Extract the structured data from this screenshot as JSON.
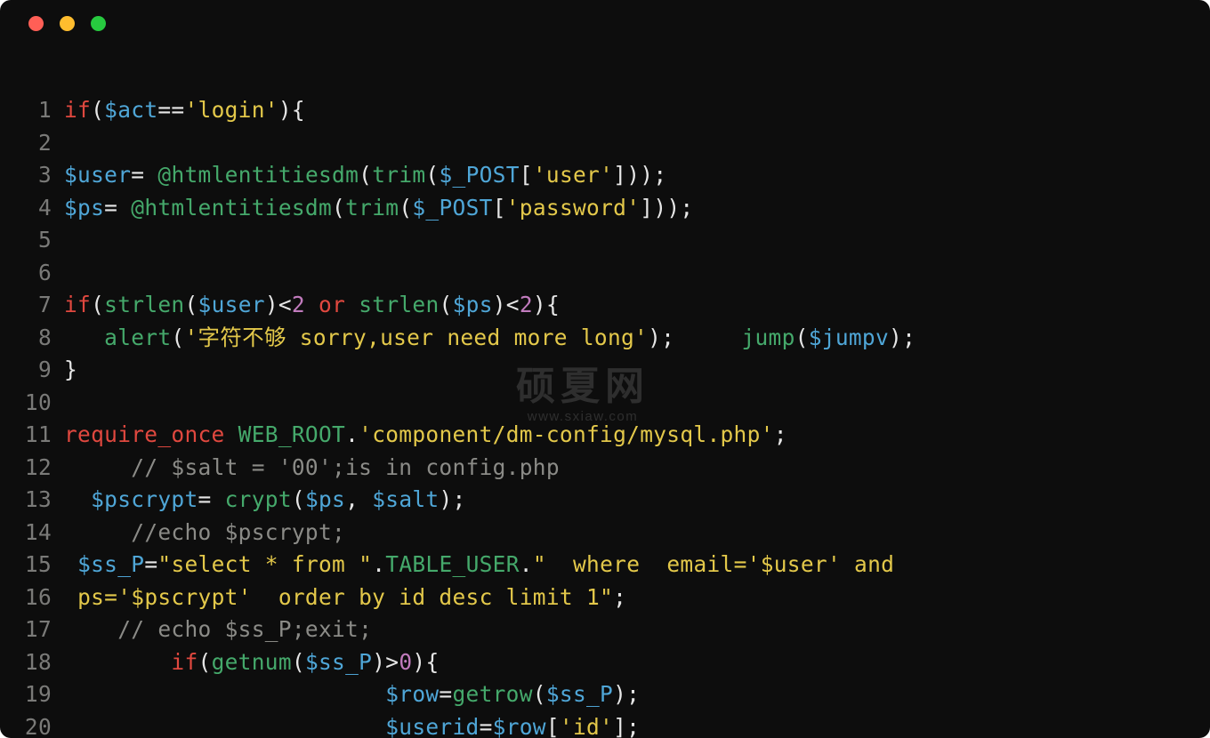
{
  "window": {
    "traffic_lights": [
      "red",
      "yellow",
      "green"
    ]
  },
  "watermark": {
    "title": "硕夏网",
    "url": "www.sxiaw.com"
  },
  "code": {
    "language": "php",
    "lines": [
      {
        "n": 1,
        "tokens": [
          [
            "kw",
            "if"
          ],
          [
            "p",
            "("
          ],
          [
            "var",
            "$act"
          ],
          [
            "p",
            "=="
          ],
          [
            "str",
            "'login'"
          ],
          [
            "p",
            "){"
          ]
        ]
      },
      {
        "n": 2,
        "tokens": []
      },
      {
        "n": 3,
        "tokens": [
          [
            "var",
            "$user"
          ],
          [
            "p",
            "= "
          ],
          [
            "at",
            "@"
          ],
          [
            "fn",
            "htmlentitiesdm"
          ],
          [
            "p",
            "("
          ],
          [
            "fn",
            "trim"
          ],
          [
            "p",
            "("
          ],
          [
            "var",
            "$_POST"
          ],
          [
            "p",
            "["
          ],
          [
            "str",
            "'user'"
          ],
          [
            "p",
            "]));"
          ]
        ]
      },
      {
        "n": 4,
        "tokens": [
          [
            "var",
            "$ps"
          ],
          [
            "p",
            "= "
          ],
          [
            "at",
            "@"
          ],
          [
            "fn",
            "htmlentitiesdm"
          ],
          [
            "p",
            "("
          ],
          [
            "fn",
            "trim"
          ],
          [
            "p",
            "("
          ],
          [
            "var",
            "$_POST"
          ],
          [
            "p",
            "["
          ],
          [
            "str",
            "'password'"
          ],
          [
            "p",
            "]));"
          ]
        ]
      },
      {
        "n": 5,
        "tokens": []
      },
      {
        "n": 6,
        "tokens": []
      },
      {
        "n": 7,
        "tokens": [
          [
            "kw",
            "if"
          ],
          [
            "p",
            "("
          ],
          [
            "fn",
            "strlen"
          ],
          [
            "p",
            "("
          ],
          [
            "var",
            "$user"
          ],
          [
            "p",
            ")<"
          ],
          [
            "num",
            "2"
          ],
          [
            "p",
            " "
          ],
          [
            "kw",
            "or"
          ],
          [
            "p",
            " "
          ],
          [
            "fn",
            "strlen"
          ],
          [
            "p",
            "("
          ],
          [
            "var",
            "$ps"
          ],
          [
            "p",
            ")<"
          ],
          [
            "num",
            "2"
          ],
          [
            "p",
            "){"
          ]
        ]
      },
      {
        "n": 8,
        "tokens": [
          [
            "p",
            "   "
          ],
          [
            "fn",
            "alert"
          ],
          [
            "p",
            "("
          ],
          [
            "str",
            "'字符不够 sorry,user need more long'"
          ],
          [
            "p",
            ");     "
          ],
          [
            "fn",
            "jump"
          ],
          [
            "p",
            "("
          ],
          [
            "var",
            "$jumpv"
          ],
          [
            "p",
            ");"
          ]
        ]
      },
      {
        "n": 9,
        "tokens": [
          [
            "p",
            "}"
          ]
        ]
      },
      {
        "n": 10,
        "tokens": []
      },
      {
        "n": 11,
        "tokens": [
          [
            "kw",
            "require_once"
          ],
          [
            "p",
            " "
          ],
          [
            "const",
            "WEB_ROOT"
          ],
          [
            "p",
            "."
          ],
          [
            "str",
            "'component/dm-config/mysql.php'"
          ],
          [
            "p",
            ";"
          ]
        ]
      },
      {
        "n": 12,
        "tokens": [
          [
            "p",
            "     "
          ],
          [
            "cmt",
            "// $salt = '00';is in config.php"
          ]
        ]
      },
      {
        "n": 13,
        "tokens": [
          [
            "p",
            "  "
          ],
          [
            "var",
            "$pscrypt"
          ],
          [
            "p",
            "= "
          ],
          [
            "fn",
            "crypt"
          ],
          [
            "p",
            "("
          ],
          [
            "var",
            "$ps"
          ],
          [
            "p",
            ", "
          ],
          [
            "var",
            "$salt"
          ],
          [
            "p",
            ");"
          ]
        ]
      },
      {
        "n": 14,
        "tokens": [
          [
            "p",
            "     "
          ],
          [
            "cmt",
            "//echo $pscrypt;"
          ]
        ]
      },
      {
        "n": 15,
        "tokens": [
          [
            "p",
            " "
          ],
          [
            "var",
            "$ss_P"
          ],
          [
            "p",
            "="
          ],
          [
            "str",
            "\"select * from \""
          ],
          [
            "p",
            "."
          ],
          [
            "const",
            "TABLE_USER"
          ],
          [
            "p",
            "."
          ],
          [
            "str",
            "\"  where  email='$user' and"
          ]
        ]
      },
      {
        "n": 16,
        "tokens": [
          [
            "p",
            " "
          ],
          [
            "str",
            "ps='$pscrypt'  order by id desc limit 1\""
          ],
          [
            "p",
            ";"
          ]
        ]
      },
      {
        "n": 17,
        "tokens": [
          [
            "p",
            "    "
          ],
          [
            "cmt",
            "// echo $ss_P;exit;"
          ]
        ]
      },
      {
        "n": 18,
        "tokens": [
          [
            "p",
            "        "
          ],
          [
            "kw",
            "if"
          ],
          [
            "p",
            "("
          ],
          [
            "fn",
            "getnum"
          ],
          [
            "p",
            "("
          ],
          [
            "var",
            "$ss_P"
          ],
          [
            "p",
            ")>"
          ],
          [
            "num",
            "0"
          ],
          [
            "p",
            "){"
          ]
        ]
      },
      {
        "n": 19,
        "tokens": [
          [
            "p",
            "                        "
          ],
          [
            "var",
            "$row"
          ],
          [
            "p",
            "="
          ],
          [
            "fn",
            "getrow"
          ],
          [
            "p",
            "("
          ],
          [
            "var",
            "$ss_P"
          ],
          [
            "p",
            ");"
          ]
        ]
      },
      {
        "n": 20,
        "tokens": [
          [
            "p",
            "                        "
          ],
          [
            "var",
            "$userid"
          ],
          [
            "p",
            "="
          ],
          [
            "var",
            "$row"
          ],
          [
            "p",
            "["
          ],
          [
            "str",
            "'id'"
          ],
          [
            "p",
            "];"
          ]
        ]
      }
    ]
  }
}
